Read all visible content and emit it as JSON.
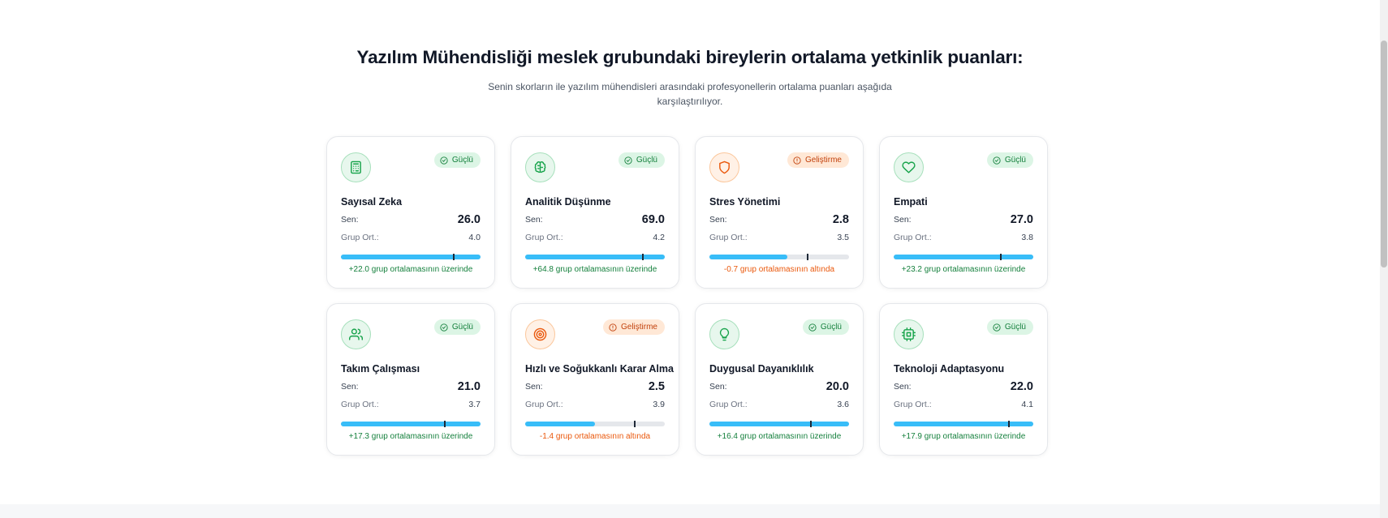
{
  "header": {
    "title": "Yazılım Mühendisliği meslek grubundaki bireylerin ortalama yetkinlik puanları:",
    "subtitle": "Senin skorların ile yazılım mühendisleri arasındaki profesyonellerin ortalama puanları aşağıda karşılaştırılıyor."
  },
  "labels": {
    "you": "Sen:",
    "group_avg": "Grup Ort.:"
  },
  "colors": {
    "strong": "#15803d",
    "develop": "#c2410c",
    "bar": "#38bdf8"
  },
  "cards": [
    {
      "title": "Sayısal Zeka",
      "icon": "calculator-icon",
      "tone": "green",
      "badge": "Güçlü",
      "you": "26.0",
      "avg": "4.0",
      "diff": "+22.0 grup ortalamasının üzerinde",
      "fill": 1.0,
      "marker": 0.8
    },
    {
      "title": "Analitik Düşünme",
      "icon": "brain-icon",
      "tone": "green",
      "badge": "Güçlü",
      "you": "69.0",
      "avg": "4.2",
      "diff": "+64.8 grup ortalamasının üzerinde",
      "fill": 1.0,
      "marker": 0.84
    },
    {
      "title": "Stres Yönetimi",
      "icon": "shield-icon",
      "tone": "orange",
      "badge": "Geliştirme",
      "you": "2.8",
      "avg": "3.5",
      "diff": "-0.7 grup ortalamasının altında",
      "fill": 0.56,
      "marker": 0.7
    },
    {
      "title": "Empati",
      "icon": "heart-icon",
      "tone": "green",
      "badge": "Güçlü",
      "you": "27.0",
      "avg": "3.8",
      "diff": "+23.2 grup ortalamasının üzerinde",
      "fill": 1.0,
      "marker": 0.76
    },
    {
      "title": "Takım Çalışması",
      "icon": "users-icon",
      "tone": "green",
      "badge": "Güçlü",
      "you": "21.0",
      "avg": "3.7",
      "diff": "+17.3 grup ortalamasının üzerinde",
      "fill": 1.0,
      "marker": 0.74
    },
    {
      "title": "Hızlı ve Soğukkanlı Karar Alma",
      "icon": "target-icon",
      "tone": "orange",
      "badge": "Geliştirme",
      "you": "2.5",
      "avg": "3.9",
      "diff": "-1.4 grup ortalamasının altında",
      "fill": 0.5,
      "marker": 0.78
    },
    {
      "title": "Duygusal Dayanıklılık",
      "icon": "lightbulb-icon",
      "tone": "green",
      "badge": "Güçlü",
      "you": "20.0",
      "avg": "3.6",
      "diff": "+16.4 grup ortalamasının üzerinde",
      "fill": 1.0,
      "marker": 0.72
    },
    {
      "title": "Teknoloji Adaptasyonu",
      "icon": "cpu-icon",
      "tone": "green",
      "badge": "Güçlü",
      "you": "22.0",
      "avg": "4.1",
      "diff": "+17.9 grup ortalamasının üzerinde",
      "fill": 1.0,
      "marker": 0.82
    }
  ]
}
